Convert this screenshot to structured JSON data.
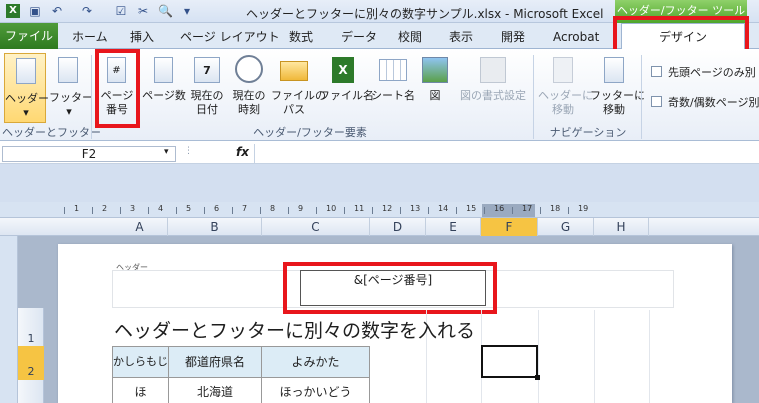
{
  "window": {
    "title": "ヘッダーとフッターに別々の数字サンプル.xlsx  -  Microsoft Excel",
    "context_tools": "ヘッダー/フッター ツール"
  },
  "tabs": {
    "file": "ファイル",
    "home": "ホーム",
    "insert": "挿入",
    "page_layout": "ページ レイアウト",
    "formulas": "数式",
    "data": "データ",
    "review": "校閲",
    "view": "表示",
    "developer": "開発",
    "acrobat": "Acrobat",
    "design": "デザイン"
  },
  "ribbon": {
    "header": "ヘッダー",
    "footer": "フッター",
    "group_header_footer": "ヘッダーとフッター",
    "page_number_l1": "ページ",
    "page_number_l2": "番号",
    "page_count": "ページ数",
    "current_date_l1": "現在の",
    "current_date_l2": "日付",
    "current_time_l1": "現在の",
    "current_time_l2": "時刻",
    "file_path_l1": "ファイルの",
    "file_path_l2": "パス",
    "file_name": "ファイル名",
    "sheet_name": "シート名",
    "picture": "図",
    "format_picture": "図の書式設定",
    "group_elements": "ヘッダー/フッター要素",
    "goto_header_l1": "ヘッダーに",
    "goto_header_l2": "移動",
    "goto_footer_l1": "フッターに",
    "goto_footer_l2": "移動",
    "group_navigation": "ナビゲーション",
    "different_first_page": "先頭ページのみ別",
    "different_odd_even": "奇数/偶数ページ別"
  },
  "formula_bar": {
    "name_box": "F2",
    "fx": "fx"
  },
  "ruler": {
    "numbers": [
      "1",
      "2",
      "3",
      "4",
      "5",
      "6",
      "7",
      "8",
      "9",
      "10",
      "11",
      "12",
      "13",
      "14",
      "15",
      "16",
      "17",
      "18",
      "19"
    ]
  },
  "columns": [
    "A",
    "B",
    "C",
    "D",
    "E",
    "F",
    "G",
    "H"
  ],
  "rows": [
    "1",
    "2"
  ],
  "sheet": {
    "header_label": "ヘッダー",
    "header_center": "&[ページ番号]",
    "title": "ヘッダーとフッターに別々の数字を入れる",
    "table_headers": [
      "かしらもじ",
      "都道府県名",
      "よみかた"
    ],
    "row1": [
      "ほ",
      "北海道",
      "ほっかいどう"
    ]
  },
  "colors": {
    "accent_red": "#e8161c",
    "file_tab": "#2e7a20",
    "context_green": "#4fa52a",
    "selected_col": "#f6c443"
  }
}
